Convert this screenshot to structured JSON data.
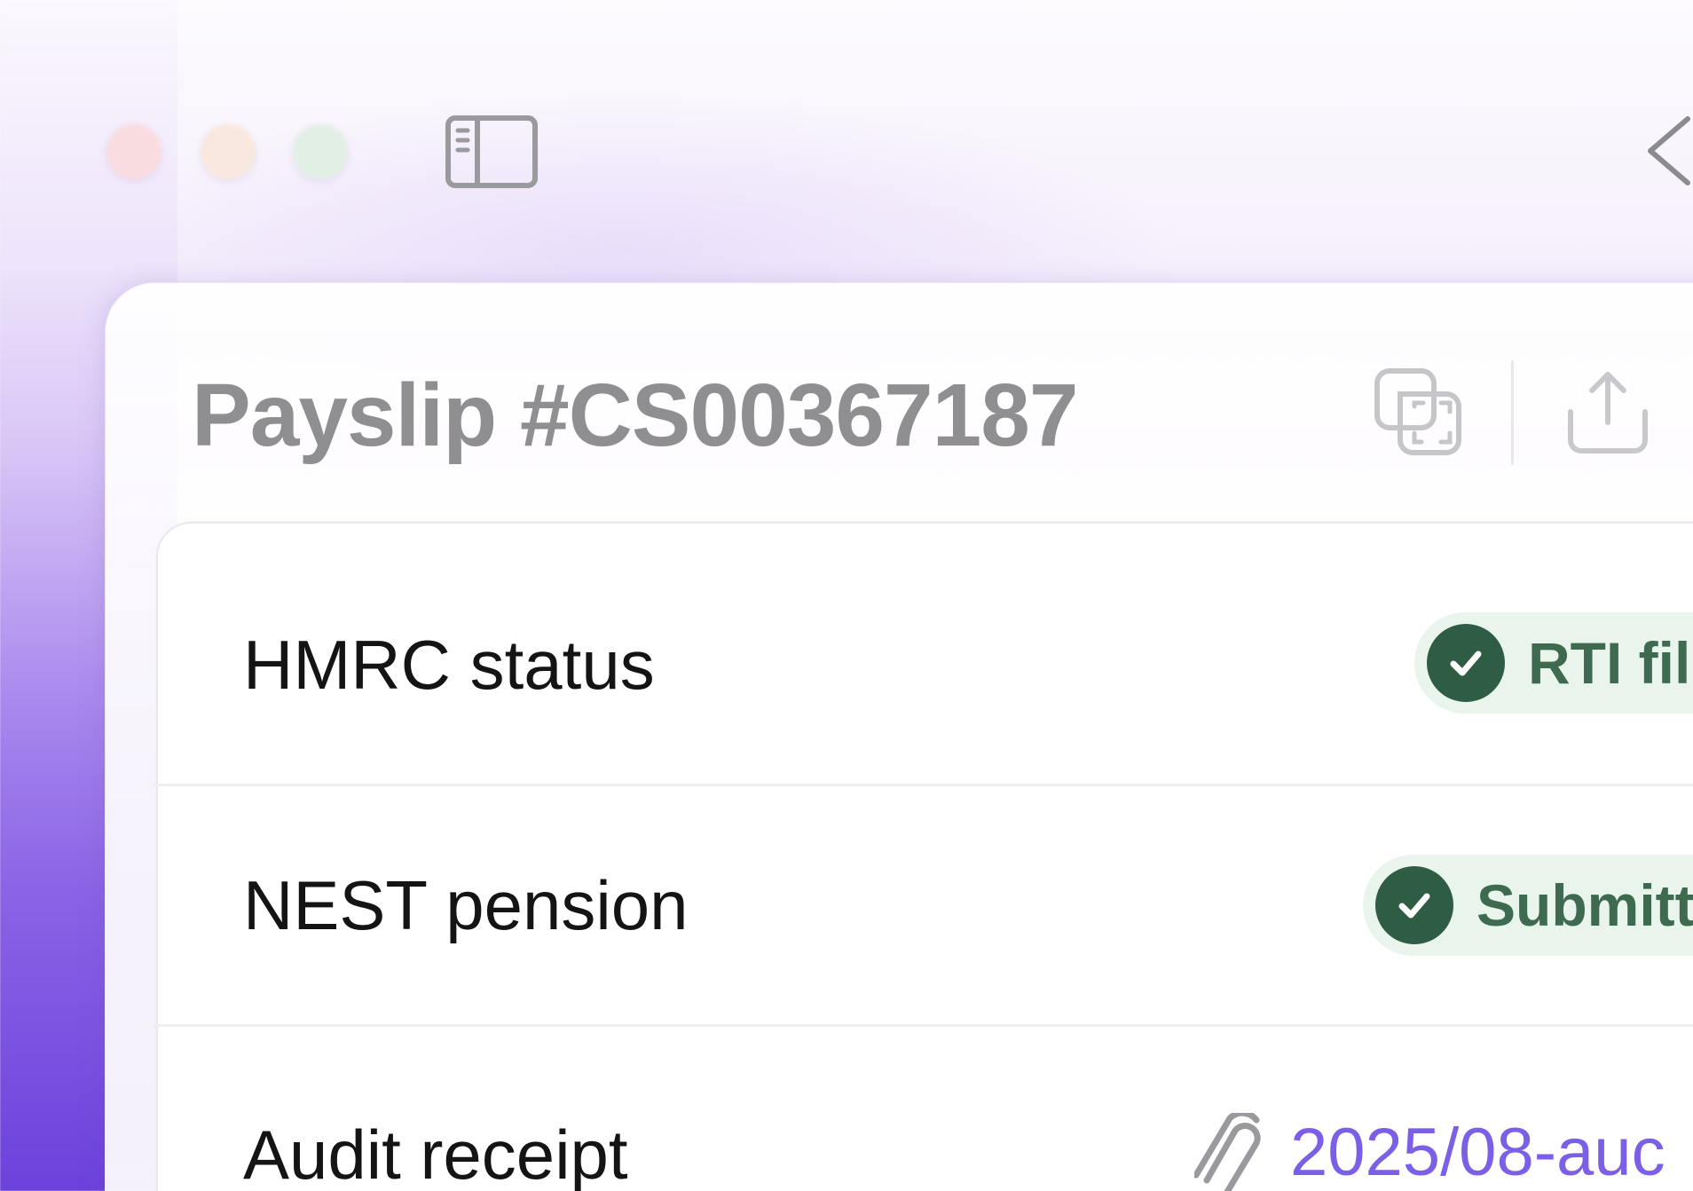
{
  "window": {
    "title": "Payslip #CS00367187"
  },
  "toolbar": {
    "sidebar_toggle_icon": "sidebar-toggle-icon",
    "back_icon": "chevron-left-icon",
    "copy_icon": "copy-icon",
    "share_icon": "share-icon"
  },
  "rows": [
    {
      "label": "HMRC status",
      "value": "RTI fil",
      "value_type": "badge",
      "status": "success"
    },
    {
      "label": "NEST pension",
      "value": "Submitt",
      "value_type": "badge",
      "status": "success"
    },
    {
      "label": "Audit receipt",
      "value": "2025/08-auc",
      "value_type": "attachment-link",
      "icon": "paperclip-icon"
    }
  ],
  "colors": {
    "accent": "#7b5fe6",
    "success_bg": "#e9f4ec",
    "success_fg": "#3e6b50",
    "success_check": "#2f5d43",
    "title_text": "#8f8f92",
    "label_text": "#141414",
    "traffic_close": "#f9dcdf",
    "traffic_min": "#f8e8df",
    "traffic_max": "#e2efe5"
  }
}
